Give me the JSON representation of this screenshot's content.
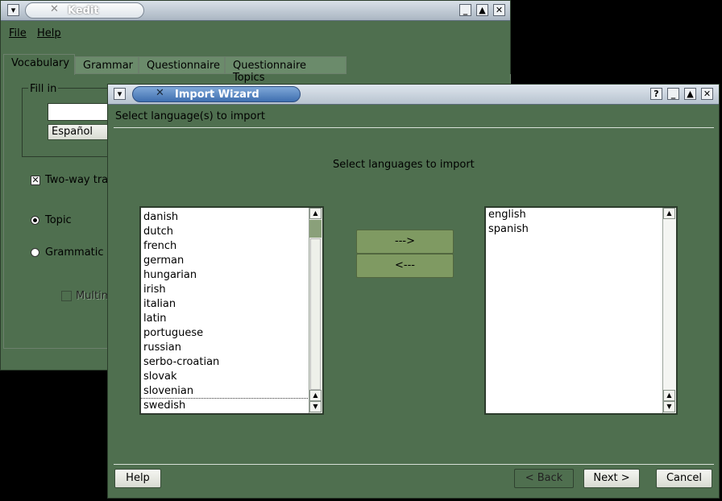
{
  "kedit": {
    "title": "Kedit",
    "menu": {
      "file": "File",
      "help": "Help"
    },
    "tabs": [
      "Vocabulary",
      "Grammar",
      "Questionnaire",
      "Questionnaire Topics"
    ],
    "fill_in_label": "Fill in",
    "language_select": "Español",
    "two_way_label": "Two-way trar",
    "topic_label": "Topic",
    "grammatic_label": "Grammatic",
    "multimedia_label": "Multime"
  },
  "wizard": {
    "title": "Import Wizard",
    "heading": "Select language(s) to import",
    "subheading": "Select languages to import",
    "available_languages": [
      "danish",
      "dutch",
      "french",
      "german",
      "hungarian",
      "irish",
      "italian",
      "latin",
      "portuguese",
      "russian",
      "serbo-croatian",
      "slovak",
      "slovenian",
      "swedish"
    ],
    "selected_languages": [
      "english",
      "spanish"
    ],
    "add_button": "--->",
    "remove_button": "<---",
    "help_button": "Help",
    "back_button": "< Back",
    "next_button": "Next >",
    "cancel_button": "Cancel"
  },
  "colors": {
    "background": "#4f6f4f",
    "titlebar_active": "#3f6fb0"
  }
}
